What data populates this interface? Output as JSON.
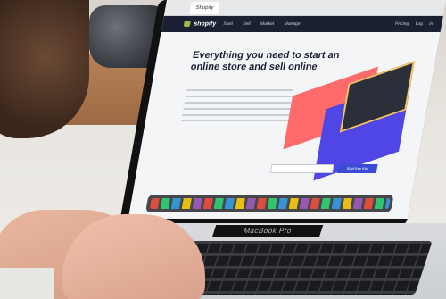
{
  "website": {
    "logo_text": "shopify",
    "headline": "Everything you need to start an online store and sell online",
    "menu": "Start Sell Market Manage",
    "right_menu": "Pricing Log in",
    "cta": "Start free trial"
  },
  "device": {
    "brand_plate": "MacBook Pro"
  },
  "colors": {
    "nav_bg": "#1c2033",
    "cta_bg": "#3b4bd6",
    "accent_green": "#95bf47"
  }
}
